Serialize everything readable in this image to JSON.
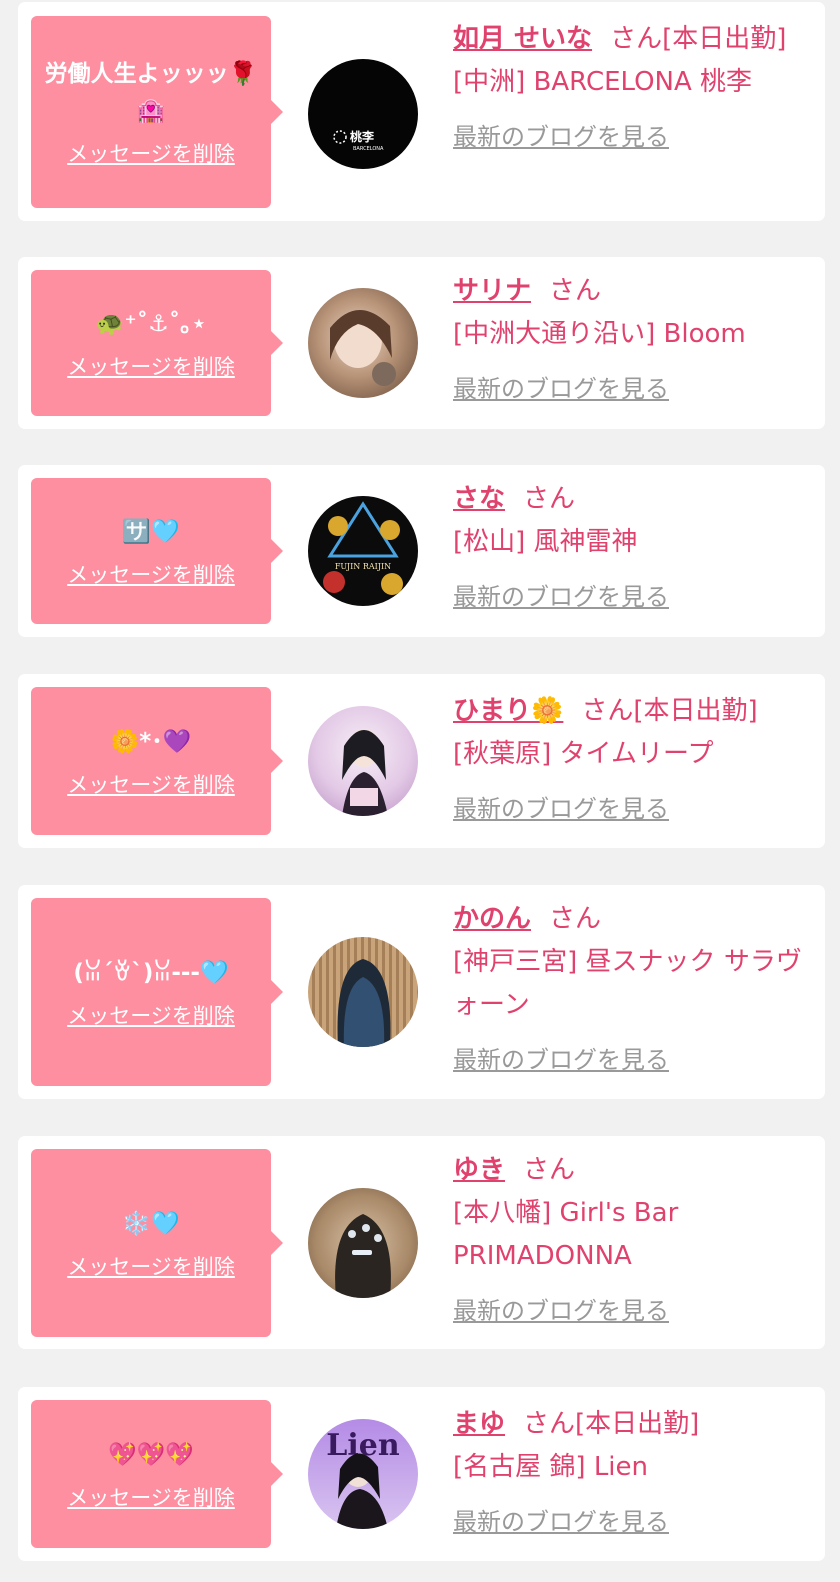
{
  "delete_label": "メッセージを削除",
  "blog_label": "最新のブログを見る",
  "san_label": "さん",
  "colors": {
    "accent": "#e0426e",
    "bubble": "#fd8fa0",
    "link_gray": "#999999",
    "background": "#f1f1f1"
  },
  "entries": [
    {
      "message": "労働人生よッッッ🌹🏩",
      "name": "如月 せいな",
      "badge": "[本日出勤]",
      "shop": "[中洲] BARCELONA 桃李",
      "avatar_text": "桃李",
      "avatar_subtext": "BARCELONA"
    },
    {
      "message": "🐢⁺˚⚓︎˚｡⋆",
      "name": "サリナ",
      "badge": "",
      "shop": "[中洲大通り沿い] Bloom"
    },
    {
      "message": "🈂️🩵",
      "name": "さな",
      "badge": "",
      "shop": "[松山] 風神雷神",
      "avatar_text": "FUJIN RAIJIN"
    },
    {
      "message": "🌼*･💜",
      "name": "ひまり🌼",
      "badge": "[本日出勤]",
      "shop": "[秋葉原] タイムリープ"
    },
    {
      "message": "(ꈍ´ꈊ`)ꈍ---🩵",
      "name": "かのん",
      "badge": "",
      "shop": "[神戸三宮] 昼スナック サラヴォーン"
    },
    {
      "message": "❄️🩵",
      "name": "ゆき",
      "badge": "",
      "shop": "[本八幡] Girl's Bar PRIMADONNA"
    },
    {
      "message": "💖💖💖",
      "name": "まゆ",
      "badge": "[本日出勤]",
      "shop": "[名古屋 錦] Lien",
      "avatar_text": "Lien"
    }
  ]
}
